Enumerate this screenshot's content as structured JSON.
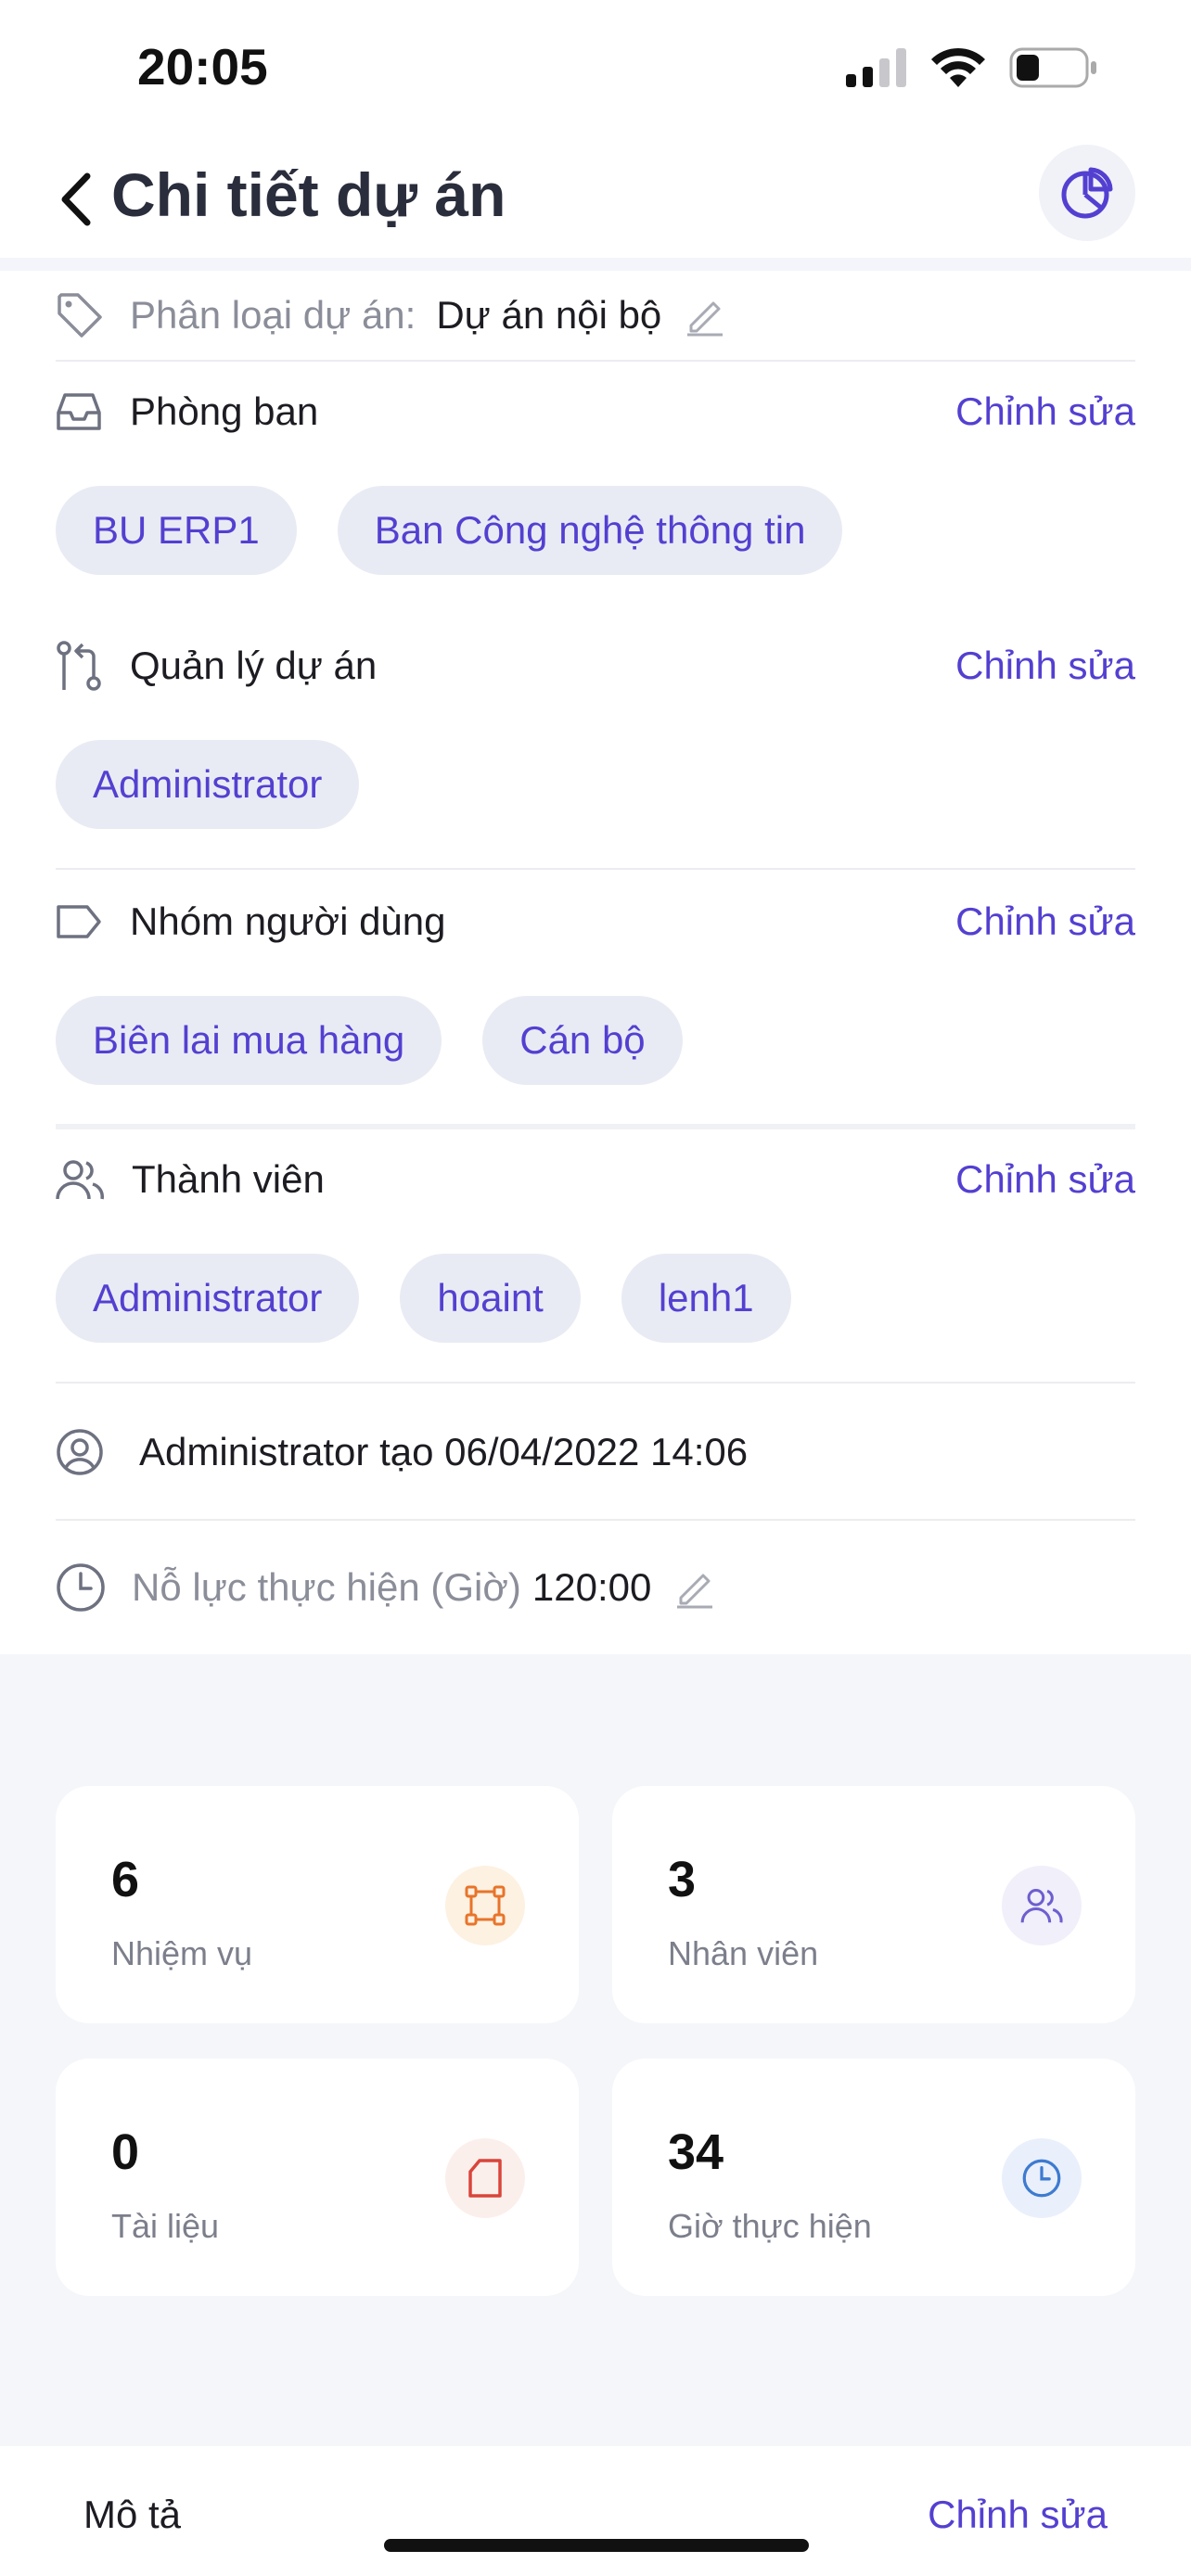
{
  "status_bar": {
    "time": "20:05"
  },
  "header": {
    "title": "Chi tiết dự án"
  },
  "classification": {
    "label": "Phân loại dự án:",
    "value": "Dự án nội bộ"
  },
  "departments": {
    "label": "Phòng ban",
    "edit": "Chỉnh sửa",
    "items": [
      "BU ERP1",
      "Ban Công nghệ thông tin"
    ]
  },
  "managers": {
    "label": "Quản lý dự án",
    "edit": "Chỉnh sửa",
    "items": [
      "Administrator"
    ]
  },
  "user_groups": {
    "label": "Nhóm người dùng",
    "edit": "Chỉnh sửa",
    "items": [
      "Biên lai mua hàng",
      "Cán bộ"
    ]
  },
  "members": {
    "label": "Thành viên",
    "edit": "Chỉnh sửa",
    "items": [
      "Administrator",
      "hoaint",
      "lenh1"
    ]
  },
  "created": {
    "text": "Administrator tạo 06/04/2022 14:06"
  },
  "effort": {
    "label": "Nỗ lực thực hiện (Giờ)",
    "value": "120:00"
  },
  "stats": [
    {
      "value": "6",
      "label": "Nhiệm vụ",
      "icon": "task-graph-icon",
      "color": "#e8742a",
      "bg": "#fdf1e2"
    },
    {
      "value": "3",
      "label": "Nhân viên",
      "icon": "people-icon",
      "color": "#6d5fcf",
      "bg": "#f0effa"
    },
    {
      "value": "0",
      "label": "Tài liệu",
      "icon": "document-icon",
      "color": "#d9453b",
      "bg": "#fbefec"
    },
    {
      "value": "34",
      "label": "Giờ thực hiện",
      "icon": "clock-icon",
      "color": "#3e7bd0",
      "bg": "#e9f0fb"
    }
  ],
  "description": {
    "label": "Mô tả",
    "edit": "Chỉnh sửa"
  }
}
